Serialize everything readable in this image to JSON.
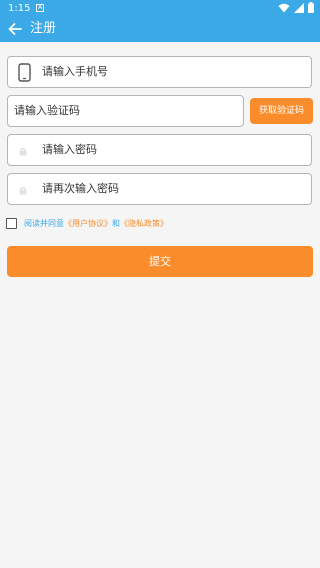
{
  "status_bar": {
    "time": "1:15",
    "notif_glyph": "A"
  },
  "header": {
    "title": "注册",
    "back_icon": "arrow-left-icon",
    "bg_color": "#3aa9e6"
  },
  "form": {
    "phone_placeholder": "请输入手机号",
    "code_placeholder": "请输入验证码",
    "get_code_label": "获取验证码",
    "password_placeholder": "请输入密码",
    "confirm_password_placeholder": "请再次输入密码"
  },
  "agreement": {
    "prefix": "阅读并同意",
    "user_agreement": "《用户协议》",
    "connector": "和",
    "privacy_policy": "《隐私政策》",
    "checked": false
  },
  "submit_label": "提交",
  "colors": {
    "accent": "#fb8c2c",
    "primary": "#3aa9e6"
  }
}
